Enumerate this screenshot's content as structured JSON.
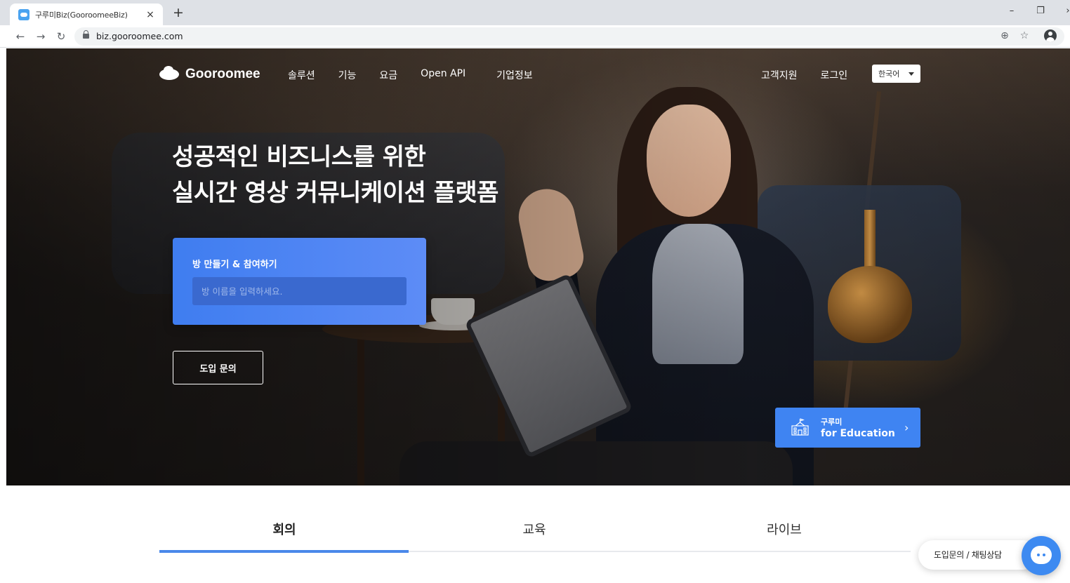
{
  "browser": {
    "tab_title": "구루미Biz(GooroomeeBiz)",
    "tab_close": "×",
    "new_tab": "+",
    "url": "biz.gooroomee.com",
    "nav_icons": {
      "back": "arrow-left-icon",
      "forward": "arrow-right-icon",
      "reload": "reload-icon"
    }
  },
  "site": {
    "logo_text": "Gooroomee",
    "nav": [
      "솔루션",
      "기능",
      "요금",
      "Open API",
      "기업정보"
    ],
    "util": [
      "고객지원",
      "로그인"
    ],
    "language": "한국어"
  },
  "hero": {
    "title_line1": "성공적인 비즈니스를 위한",
    "title_line2": "실시간 영상 커뮤니케이션 플랫폼",
    "room_card_title": "방 만들기 & 참여하기",
    "room_input_placeholder": "방 이름을 입력하세요.",
    "inquiry_button": "도입 문의",
    "edu_line1": "구루미",
    "edu_line2": "for Education",
    "edu_chevron": "›"
  },
  "tabs": [
    "회의",
    "교육",
    "라이브"
  ],
  "active_tab_index": 0,
  "chat": {
    "label": "도입문의 / 채팅상담"
  },
  "colors": {
    "accent": "#3f84f2",
    "tab_active": "#4a88ea",
    "card_start": "#3f7df0",
    "card_end": "#5d8cf6"
  }
}
